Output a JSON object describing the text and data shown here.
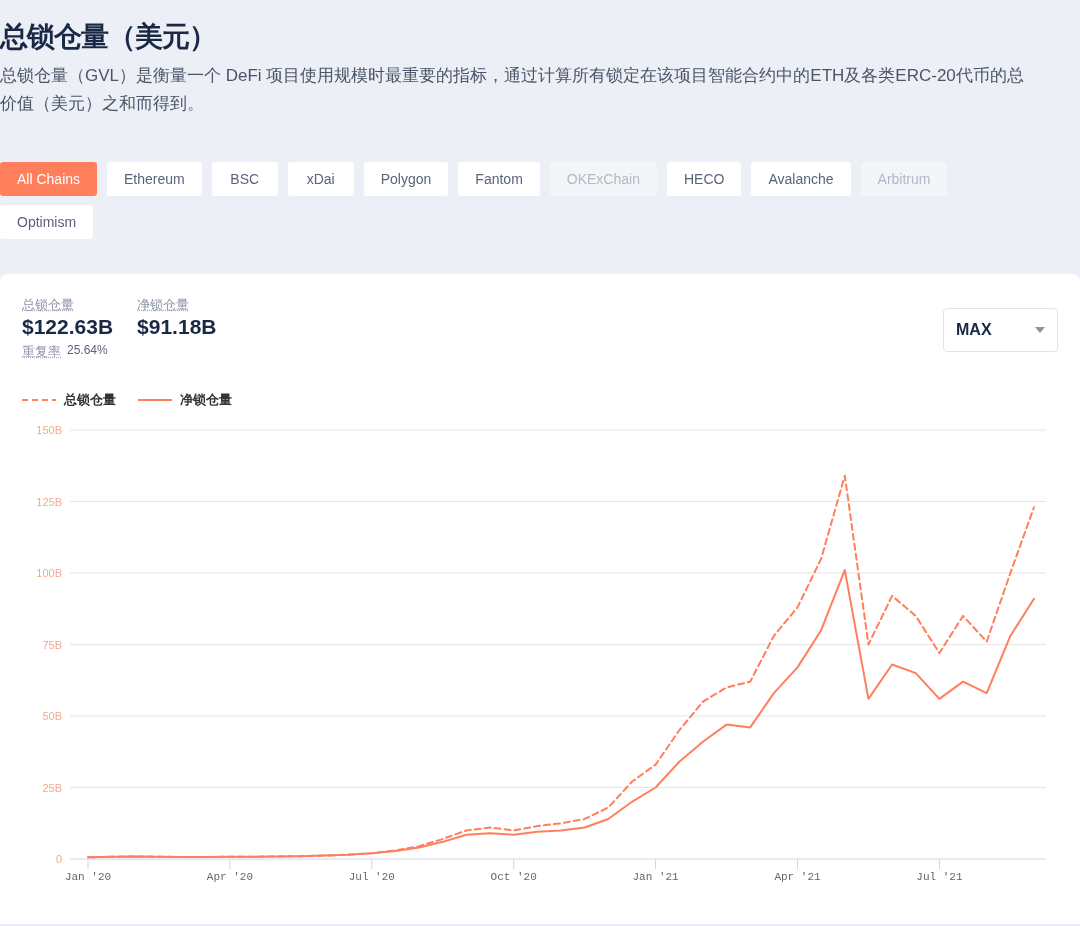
{
  "header": {
    "title": "总锁仓量（美元）",
    "description": "总锁仓量（GVL）是衡量一个 DeFi 项目使用规模时最重要的指标，通过计算所有锁定在该项目智能合约中的ETH及各类ERC-20代币的总价值（美元）之和而得到。"
  },
  "chains": [
    {
      "label": "All Chains",
      "selected": true,
      "disabled": false
    },
    {
      "label": "Ethereum",
      "selected": false,
      "disabled": false
    },
    {
      "label": "BSC",
      "selected": false,
      "disabled": false
    },
    {
      "label": "xDai",
      "selected": false,
      "disabled": false
    },
    {
      "label": "Polygon",
      "selected": false,
      "disabled": false
    },
    {
      "label": "Fantom",
      "selected": false,
      "disabled": false
    },
    {
      "label": "OKExChain",
      "selected": false,
      "disabled": true
    },
    {
      "label": "HECO",
      "selected": false,
      "disabled": false
    },
    {
      "label": "Avalanche",
      "selected": false,
      "disabled": false
    },
    {
      "label": "Arbitrum",
      "selected": false,
      "disabled": true
    },
    {
      "label": "Optimism",
      "selected": false,
      "disabled": false
    }
  ],
  "stats": [
    {
      "label": "总锁仓量",
      "value": "$122.63B"
    },
    {
      "label": "净锁仓量",
      "value": "$91.18B"
    }
  ],
  "repeat_rate": {
    "label": "重复率",
    "value": "25.64%"
  },
  "range_select": {
    "value": "MAX"
  },
  "chart": {
    "chart_data": {
      "type": "line",
      "categories": [
        "Jan '20",
        null,
        null,
        null,
        null,
        null,
        "Apr '20",
        null,
        null,
        null,
        null,
        null,
        "Jul '20",
        null,
        null,
        null,
        null,
        null,
        "Oct '20",
        null,
        null,
        null,
        null,
        null,
        "Jan '21",
        null,
        null,
        null,
        null,
        null,
        "Apr '21",
        null,
        null,
        null,
        null,
        null,
        "Jul '21",
        null,
        null,
        null,
        null
      ],
      "series": [
        {
          "name": "总锁仓量",
          "color": "#ff7f5c",
          "line_style": "dashed",
          "values": [
            0.6,
            0.8,
            0.9,
            0.8,
            0.7,
            0.7,
            0.8,
            0.8,
            0.9,
            1.0,
            1.2,
            1.5,
            2.0,
            3,
            4.5,
            7,
            10,
            11,
            10,
            11.5,
            12.5,
            14,
            18,
            27,
            33,
            45,
            55,
            60,
            62,
            78,
            88,
            105,
            134,
            75,
            92,
            85,
            72,
            85,
            76,
            100,
            123
          ]
        },
        {
          "name": "净锁仓量",
          "color": "#ff7f5c",
          "line_style": "solid",
          "values": [
            0.6,
            0.8,
            0.9,
            0.8,
            0.7,
            0.7,
            0.8,
            0.8,
            0.9,
            1.0,
            1.2,
            1.5,
            2.0,
            2.8,
            4,
            6,
            8.5,
            9,
            8.5,
            9.5,
            10,
            11,
            14,
            20,
            25,
            34,
            41,
            47,
            46,
            58,
            67,
            80,
            101,
            56,
            68,
            65,
            56,
            62,
            58,
            78,
            91
          ]
        }
      ],
      "ylim": [
        0,
        150
      ],
      "grid": true,
      "yticks": [
        {
          "value": 0,
          "label": "0"
        },
        {
          "value": 25,
          "label": "25B"
        },
        {
          "value": 50,
          "label": "50B"
        },
        {
          "value": 75,
          "label": "75B"
        },
        {
          "value": 100,
          "label": "100B"
        },
        {
          "value": 125,
          "label": "125B"
        },
        {
          "value": 150,
          "label": "150B"
        }
      ]
    }
  }
}
